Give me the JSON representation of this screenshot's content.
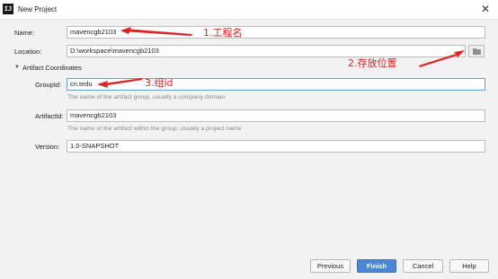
{
  "window": {
    "title": "New Project",
    "app_icon_text": "IJ",
    "close_glyph": "✕"
  },
  "form": {
    "name": {
      "label": "Name:",
      "value": "mavencgb2103"
    },
    "location": {
      "label": "Location:",
      "value": "D:\\workspace\\mavencgb2103"
    },
    "artifact_section": {
      "caret": "▼",
      "label": "Artifact Coordinates"
    },
    "group_id": {
      "label": "GroupId:",
      "value": "cn.tedu",
      "hint": "The name of the artifact group, usually a company domain"
    },
    "artifact_id": {
      "label": "ArtifactId:",
      "value": "mavencgb2103",
      "hint": "The name of the artifact within the group, usually a project name"
    },
    "version": {
      "label": "Version:",
      "value": "1.0-SNAPSHOT"
    }
  },
  "buttons": {
    "previous": "Previous",
    "finish": "Finish",
    "cancel": "Cancel",
    "help": "Help"
  },
  "annotations": {
    "project_name": "1.工程名",
    "location": "2.存放位置",
    "group_id": "3.组id"
  },
  "colors": {
    "annotation": "#e02222",
    "primary_button": "#4a88d6",
    "focus_border": "#6a9fd8"
  },
  "icons": {
    "folder": "folder-icon",
    "close": "close-icon"
  }
}
